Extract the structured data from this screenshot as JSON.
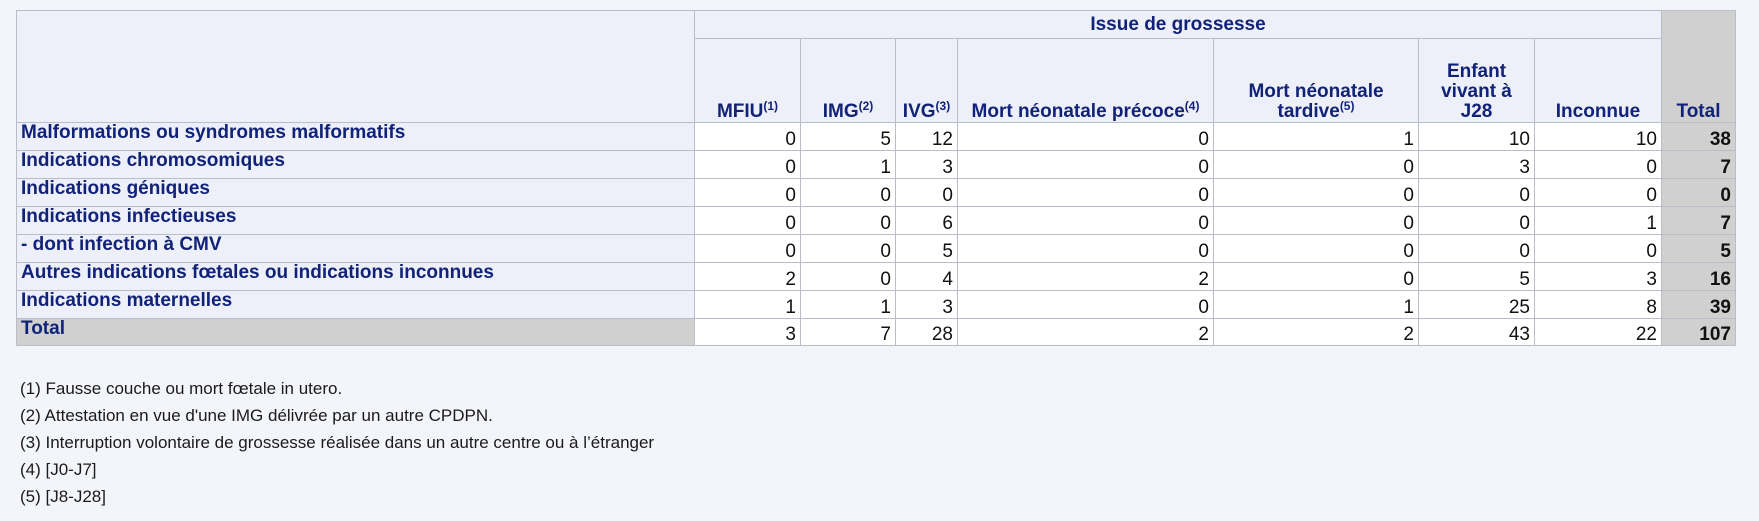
{
  "table": {
    "group_header": "Issue de grossesse",
    "total_header": "Total",
    "columns": [
      {
        "label": "MFIU",
        "sup": "(1)"
      },
      {
        "label": "IMG",
        "sup": "(2)"
      },
      {
        "label": "IVG",
        "sup": "(3)"
      },
      {
        "label": "Mort néonatale précoce",
        "sup": "(4)"
      },
      {
        "label_line1": "Mort néonatale",
        "label_line2": "tardive",
        "sup": "(5)"
      },
      {
        "label_line1": "Enfant",
        "label_line2": "vivant à",
        "label_line3": "J28"
      },
      {
        "label": "Inconnue"
      }
    ],
    "rows": [
      {
        "label": "Malformations ou syndromes malformatifs",
        "values": [
          "0",
          "5",
          "12",
          "0",
          "1",
          "10",
          "10"
        ],
        "total": "38"
      },
      {
        "label": "Indications chromosomiques",
        "values": [
          "0",
          "1",
          "3",
          "0",
          "0",
          "3",
          "0"
        ],
        "total": "7"
      },
      {
        "label": "Indications géniques",
        "values": [
          "0",
          "0",
          "0",
          "0",
          "0",
          "0",
          "0"
        ],
        "total": "0"
      },
      {
        "label": "Indications infectieuses",
        "values": [
          "0",
          "0",
          "6",
          "0",
          "0",
          "0",
          "1"
        ],
        "total": "7"
      },
      {
        "label": "- dont infection à CMV",
        "values": [
          "0",
          "0",
          "5",
          "0",
          "0",
          "0",
          "0"
        ],
        "total": "5"
      },
      {
        "label": "Autres indications fœtales ou indications inconnues",
        "values": [
          "2",
          "0",
          "4",
          "2",
          "0",
          "5",
          "3"
        ],
        "total": "16"
      },
      {
        "label": "Indications maternelles",
        "values": [
          "1",
          "1",
          "3",
          "0",
          "1",
          "25",
          "8"
        ],
        "total": "39"
      },
      {
        "label": "Total",
        "values": [
          "3",
          "7",
          "28",
          "2",
          "2",
          "43",
          "22"
        ],
        "total": "107"
      }
    ]
  },
  "footnotes": [
    "(1) Fausse couche ou mort fœtale in utero.",
    "(2) Attestation en vue d'une IMG délivrée par un autre CPDPN.",
    "(3) Interruption volontaire de grossesse réalisée dans un autre centre ou à l’étranger",
    "(4) [J0-J7]",
    "(5) [J8-J28]"
  ]
}
